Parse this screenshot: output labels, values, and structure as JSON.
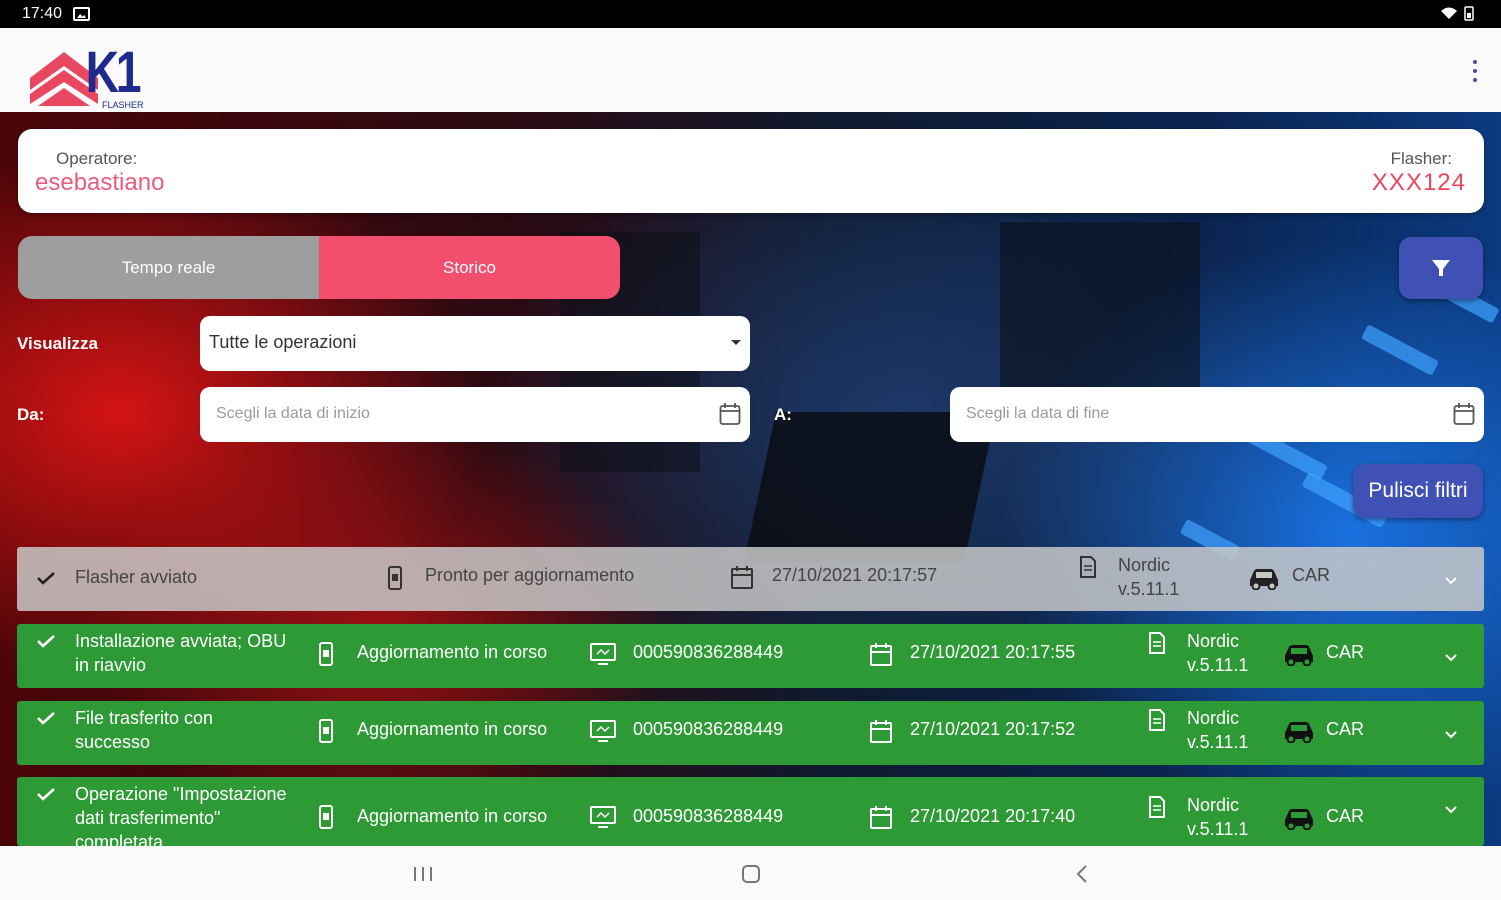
{
  "status_bar": {
    "time": "17:40",
    "right_icons": "wifi-icon, battery-icon"
  },
  "app": {
    "logo_text": "K1",
    "logo_sub": "FLASHER",
    "brand_color": "#e8475f",
    "accent_color": "#3f51b5"
  },
  "operator": {
    "label": "Operatore:",
    "value": "esebastiano"
  },
  "flasher": {
    "label": "Flasher:",
    "value": "XXX124"
  },
  "tabs": [
    {
      "label": "Tempo reale",
      "active": false
    },
    {
      "label": "Storico",
      "active": true
    }
  ],
  "filters": {
    "view_label": "Visualizza",
    "view_value": "Tutte le operazioni",
    "from_label": "Da:",
    "from_placeholder": "Scegli la data di inizio",
    "to_label": "A:",
    "to_placeholder": "Scegli la data di fine",
    "clear_label": "Pulisci filtri"
  },
  "rows": [
    {
      "status": "Flasher avviato",
      "state": "Pronto per aggiornamento",
      "device": "",
      "datetime": "27/10/2021 20:17:57",
      "fw_line1": "Nordic",
      "fw_line2": "v.5.11.1",
      "vehicle": "CAR",
      "style": "gray"
    },
    {
      "status_line1": "Installazione avviata; OBU",
      "status_line2": "in riavvio",
      "state": "Aggiornamento in corso",
      "device": "000590836288449",
      "datetime": "27/10/2021 20:17:55",
      "fw_line1": "Nordic",
      "fw_line2": "v.5.11.1",
      "vehicle": "CAR",
      "style": "green"
    },
    {
      "status_line1": "File trasferito con",
      "status_line2": "successo",
      "state": "Aggiornamento in corso",
      "device": "000590836288449",
      "datetime": "27/10/2021 20:17:52",
      "fw_line1": "Nordic",
      "fw_line2": "v.5.11.1",
      "vehicle": "CAR",
      "style": "green"
    },
    {
      "status_line1": "Operazione \"Impostazione",
      "status_line2": "dati trasferimento\"",
      "status_line3": "completata",
      "state": "Aggiornamento in corso",
      "device": "000590836288449",
      "datetime": "27/10/2021 20:17:40",
      "fw_line1": "Nordic",
      "fw_line2": "v.5.11.1",
      "vehicle": "CAR",
      "style": "green"
    }
  ]
}
